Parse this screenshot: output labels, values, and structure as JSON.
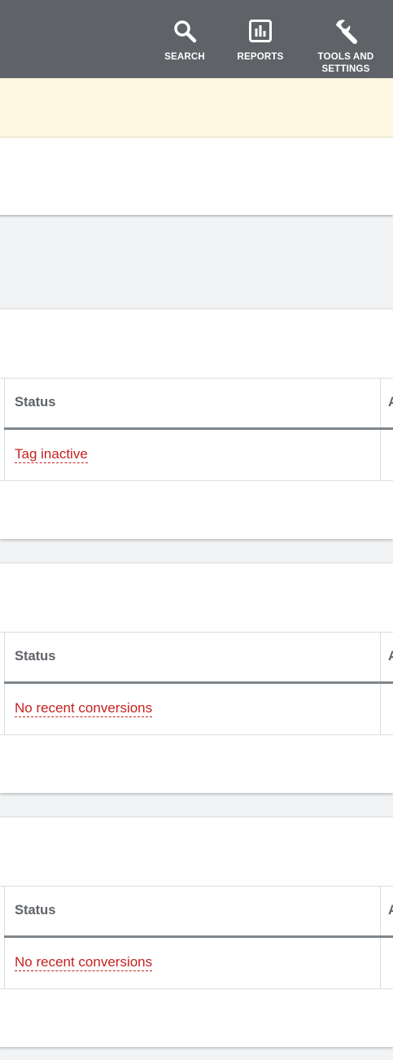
{
  "topbar": {
    "items": [
      {
        "label": "SEARCH",
        "icon": "search-icon"
      },
      {
        "label": "REPORTS",
        "icon": "reports-icon"
      },
      {
        "label": "TOOLS AND SETTINGS",
        "icon": "wrench-icon"
      }
    ]
  },
  "sections": [
    {
      "column_header": "Status",
      "next_column_header": "A",
      "status": "Tag inactive"
    },
    {
      "column_header": "Status",
      "next_column_header": "A",
      "status": "No recent conversions"
    },
    {
      "column_header": "Status",
      "next_column_header": "A",
      "status": "No recent conversions"
    }
  ],
  "colors": {
    "topbar_bg": "#5f6368",
    "banner_bg": "#fdf6e0",
    "status_error": "#c5221f",
    "page_bg": "#f1f3f4"
  }
}
